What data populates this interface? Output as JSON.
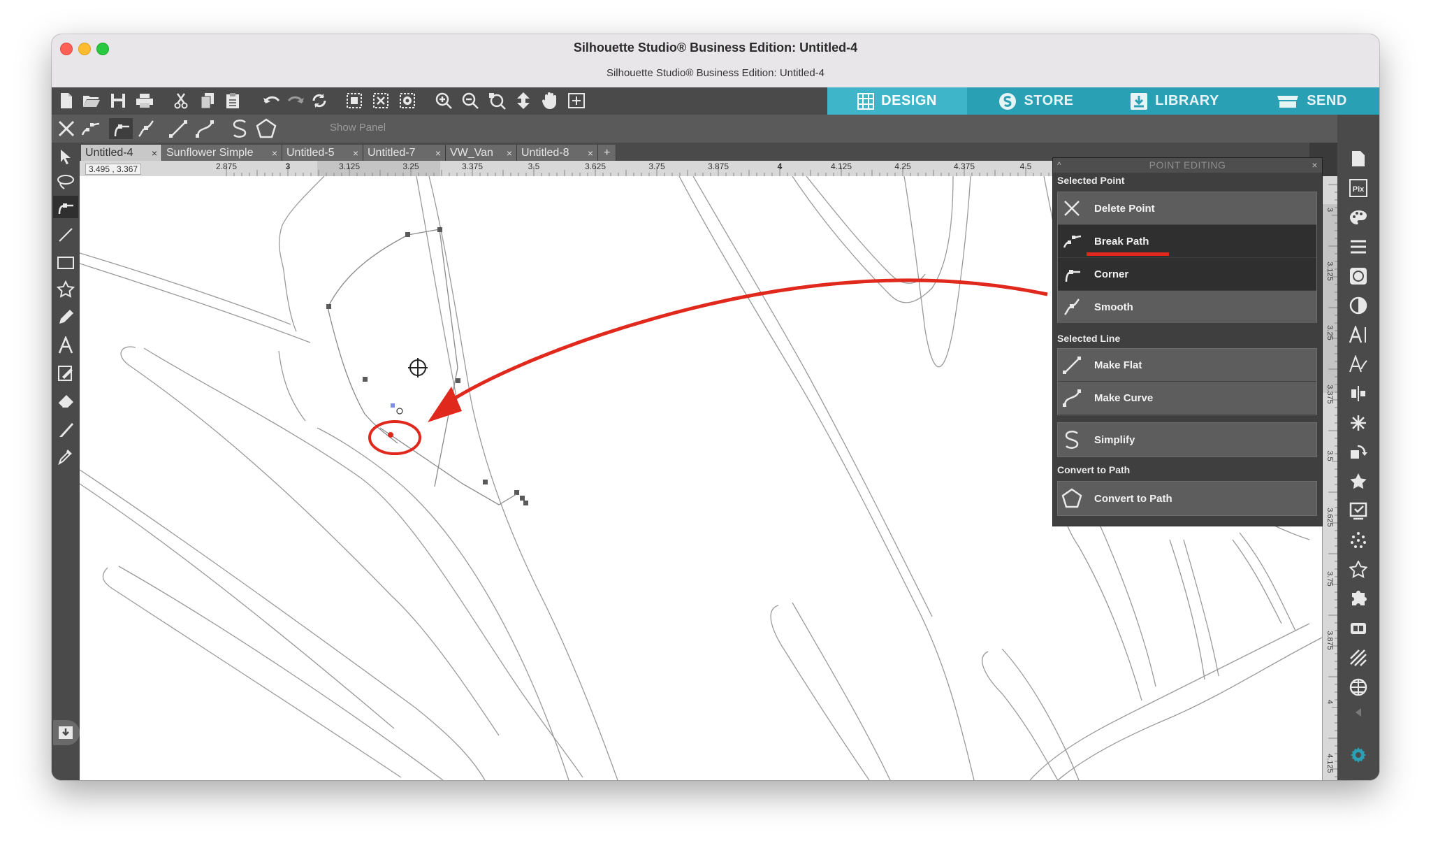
{
  "window": {
    "title": "Silhouette Studio® Business Edition: Untitled-4",
    "subtitle": "Silhouette Studio® Business Edition: Untitled-4"
  },
  "nav_tabs": [
    {
      "label": "DESIGN",
      "icon": "grid-icon",
      "active": true
    },
    {
      "label": "STORE",
      "icon": "store-s-icon",
      "active": false
    },
    {
      "label": "LIBRARY",
      "icon": "library-download-icon",
      "active": false
    },
    {
      "label": "SEND",
      "icon": "cutter-icon",
      "active": false
    }
  ],
  "point_toolbar": {
    "show_panel": "Show Panel"
  },
  "doc_tabs": [
    {
      "label": "Untitled-4",
      "active": true
    },
    {
      "label": "Sunflower Simple",
      "active": false
    },
    {
      "label": "Untitled-5",
      "active": false
    },
    {
      "label": "Untitled-7",
      "active": false
    },
    {
      "label": "VW_Van",
      "active": false
    },
    {
      "label": "Untitled-8",
      "active": false
    }
  ],
  "add_tab": "+",
  "ruler": {
    "coordinates": "3.495 , 3.367",
    "h_ticks": [
      "2.875",
      "3",
      "3.125",
      "3.25",
      "3.375",
      "3.5",
      "3.625",
      "3.75",
      "3.875",
      "4",
      "4.125",
      "4.25",
      "4.375",
      "4.5"
    ],
    "v_ticks": [
      "3",
      "3.125",
      "3.25",
      "3.375",
      "3.5",
      "3.625",
      "3.75",
      "3.875",
      "4",
      "4.125"
    ]
  },
  "point_editing": {
    "title": "POINT EDITING",
    "close": "×",
    "selected_point": {
      "title": "Selected Point",
      "items": [
        {
          "label": "Delete Point",
          "icon": "delete-x-icon"
        },
        {
          "label": "Break Path",
          "icon": "break-path-icon"
        },
        {
          "label": "Corner",
          "icon": "corner-icon"
        },
        {
          "label": "Smooth",
          "icon": "smooth-icon"
        }
      ]
    },
    "selected_line": {
      "title": "Selected Line",
      "items": [
        {
          "label": "Make Flat",
          "icon": "make-flat-icon"
        },
        {
          "label": "Make Curve",
          "icon": "make-curve-icon"
        },
        {
          "label": "Simplify",
          "icon": "simplify-icon"
        }
      ]
    },
    "convert": {
      "title": "Convert to Path",
      "items": [
        {
          "label": "Convert to Path",
          "icon": "pentagon-icon"
        }
      ]
    }
  },
  "colors": {
    "nav_bg": "#2aa0b4",
    "nav_active": "#3fb5c9",
    "annotation_red": "#e0281d",
    "settings_gear": "#2aa0b4"
  }
}
